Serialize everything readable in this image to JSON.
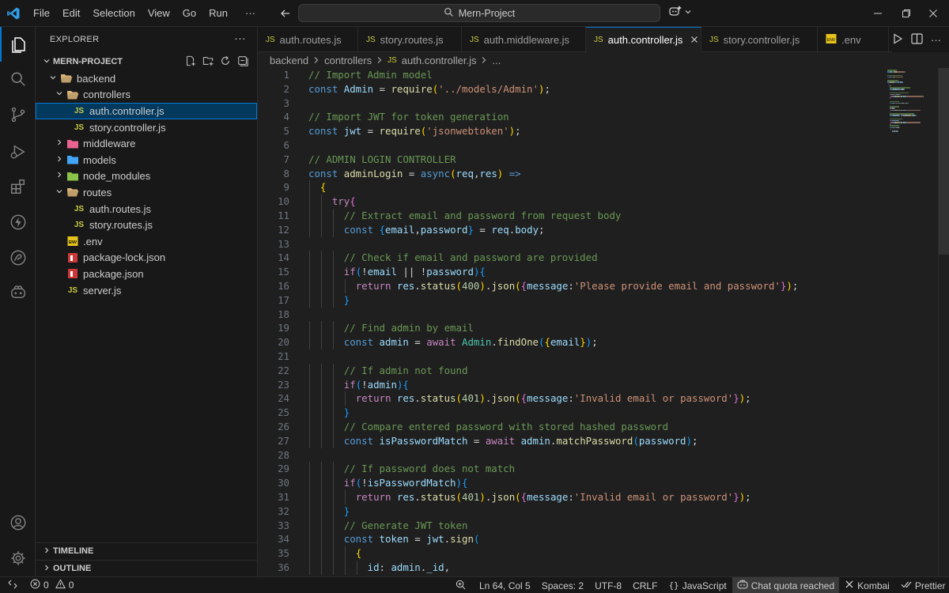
{
  "titlebar": {
    "menu": [
      "File",
      "Edit",
      "Selection",
      "View",
      "Go",
      "Run"
    ],
    "more": "···",
    "search_text": "Mern-Project"
  },
  "activity_bar": {
    "items": [
      "explorer-icon",
      "search-icon",
      "source-control-icon",
      "run-debug-icon",
      "extensions-icon",
      "lightning-icon",
      "docker-icon",
      "copilot-icon",
      "accounts-icon",
      "settings-gear-icon"
    ]
  },
  "sidebar": {
    "title": "EXPLORER",
    "project": "MERN-PROJECT",
    "tree": [
      {
        "label": "backend",
        "type": "folder",
        "open": true,
        "depth": 1
      },
      {
        "label": "controllers",
        "type": "folder",
        "open": true,
        "depth": 2
      },
      {
        "label": "auth.controller.js",
        "type": "js",
        "depth": 3,
        "selected": true
      },
      {
        "label": "story.controller.js",
        "type": "js",
        "depth": 3
      },
      {
        "label": "middleware",
        "type": "folder",
        "open": false,
        "depth": 2
      },
      {
        "label": "models",
        "type": "folder",
        "open": false,
        "depth": 2
      },
      {
        "label": "node_modules",
        "type": "folder",
        "open": false,
        "depth": 2
      },
      {
        "label": "routes",
        "type": "folder",
        "open": true,
        "depth": 2
      },
      {
        "label": "auth.routes.js",
        "type": "js",
        "depth": 3
      },
      {
        "label": "story.routes.js",
        "type": "js",
        "depth": 3
      },
      {
        "label": ".env",
        "type": "env",
        "depth": 2
      },
      {
        "label": "package-lock.json",
        "type": "npm",
        "depth": 2
      },
      {
        "label": "package.json",
        "type": "npm",
        "depth": 2
      },
      {
        "label": "server.js",
        "type": "js",
        "depth": 2
      }
    ],
    "timeline": "TIMELINE",
    "outline": "OUTLINE"
  },
  "tabs": [
    {
      "label": "auth.routes.js",
      "icon": "JS"
    },
    {
      "label": "story.routes.js",
      "icon": "JS"
    },
    {
      "label": "auth.middleware.js",
      "icon": "JS"
    },
    {
      "label": "auth.controller.js",
      "icon": "JS",
      "active": true
    },
    {
      "label": "story.controller.js",
      "icon": "JS"
    },
    {
      "label": ".env",
      "icon": "env"
    }
  ],
  "breadcrumb": {
    "parts": [
      "backend",
      "controllers",
      "auth.controller.js",
      "..."
    ],
    "icon": "JS"
  },
  "editor": {
    "lines": [
      {
        "n": "1",
        "tokens": [
          [
            "c-com",
            "// Import Admin model"
          ]
        ]
      },
      {
        "n": "2",
        "tokens": [
          [
            "c-kw",
            "const "
          ],
          [
            "c-var",
            "Admin"
          ],
          [
            "c-pun",
            " = "
          ],
          [
            "c-fn",
            "require"
          ],
          [
            "c-b1",
            "("
          ],
          [
            "c-str",
            "'../models/Admin'"
          ],
          [
            "c-b1",
            ")"
          ],
          [
            "c-pun",
            ";"
          ]
        ]
      },
      {
        "n": "3",
        "tokens": []
      },
      {
        "n": "4",
        "tokens": [
          [
            "c-com",
            "// Import JWT for token generation"
          ]
        ]
      },
      {
        "n": "5",
        "tokens": [
          [
            "c-kw",
            "const "
          ],
          [
            "c-var",
            "jwt"
          ],
          [
            "c-pun",
            " = "
          ],
          [
            "c-fn",
            "require"
          ],
          [
            "c-b1",
            "("
          ],
          [
            "c-str",
            "'jsonwebtoken'"
          ],
          [
            "c-b1",
            ")"
          ],
          [
            "c-pun",
            ";"
          ]
        ]
      },
      {
        "n": "6",
        "tokens": []
      },
      {
        "n": "7",
        "tokens": [
          [
            "c-com",
            "// ADMIN LOGIN CONTROLLER"
          ]
        ]
      },
      {
        "n": "8",
        "tokens": [
          [
            "c-kw",
            "const "
          ],
          [
            "c-fn",
            "adminLogin"
          ],
          [
            "c-pun",
            " = "
          ],
          [
            "c-kw",
            "async"
          ],
          [
            "c-b1",
            "("
          ],
          [
            "c-var",
            "req"
          ],
          [
            "c-pun",
            ","
          ],
          [
            "c-var",
            "res"
          ],
          [
            "c-b1",
            ")"
          ],
          [
            "c-kw",
            " =>"
          ]
        ]
      },
      {
        "n": "9",
        "tokens": [
          [
            "c-pun",
            "  "
          ],
          [
            "c-b1",
            "{"
          ]
        ]
      },
      {
        "n": "10",
        "tokens": [
          [
            "c-pun",
            "    "
          ],
          [
            "c-ctl",
            "try"
          ],
          [
            "c-b2",
            "{"
          ]
        ]
      },
      {
        "n": "11",
        "tokens": [
          [
            "c-pun",
            "      "
          ],
          [
            "c-com",
            "// Extract email and password from request body"
          ]
        ]
      },
      {
        "n": "12",
        "tokens": [
          [
            "c-pun",
            "      "
          ],
          [
            "c-kw",
            "const "
          ],
          [
            "c-b3",
            "{"
          ],
          [
            "c-var",
            "email"
          ],
          [
            "c-pun",
            ","
          ],
          [
            "c-var",
            "password"
          ],
          [
            "c-b3",
            "}"
          ],
          [
            "c-pun",
            " = "
          ],
          [
            "c-var",
            "req"
          ],
          [
            "c-pun",
            "."
          ],
          [
            "c-var",
            "body"
          ],
          [
            "c-pun",
            ";"
          ]
        ]
      },
      {
        "n": "13",
        "tokens": []
      },
      {
        "n": "14",
        "tokens": [
          [
            "c-pun",
            "      "
          ],
          [
            "c-com",
            "// Check if email and password are provided"
          ]
        ]
      },
      {
        "n": "15",
        "tokens": [
          [
            "c-pun",
            "      "
          ],
          [
            "c-ctl",
            "if"
          ],
          [
            "c-b3",
            "("
          ],
          [
            "c-pun",
            "!"
          ],
          [
            "c-var",
            "email"
          ],
          [
            "c-pun",
            " || !"
          ],
          [
            "c-var",
            "password"
          ],
          [
            "c-b3",
            ")"
          ],
          [
            "c-b3",
            "{"
          ]
        ]
      },
      {
        "n": "16",
        "tokens": [
          [
            "c-pun",
            "        "
          ],
          [
            "c-ctl",
            "return "
          ],
          [
            "c-var",
            "res"
          ],
          [
            "c-pun",
            "."
          ],
          [
            "c-fn",
            "status"
          ],
          [
            "c-b1",
            "("
          ],
          [
            "c-num",
            "400"
          ],
          [
            "c-b1",
            ")"
          ],
          [
            "c-pun",
            "."
          ],
          [
            "c-fn",
            "json"
          ],
          [
            "c-b1",
            "("
          ],
          [
            "c-b2",
            "{"
          ],
          [
            "c-var",
            "message"
          ],
          [
            "c-pun",
            ":"
          ],
          [
            "c-str",
            "'Please provide email and password'"
          ],
          [
            "c-b2",
            "}"
          ],
          [
            "c-b1",
            ")"
          ],
          [
            "c-pun",
            ";"
          ]
        ]
      },
      {
        "n": "17",
        "tokens": [
          [
            "c-pun",
            "      "
          ],
          [
            "c-b3",
            "}"
          ]
        ]
      },
      {
        "n": "18",
        "tokens": []
      },
      {
        "n": "19",
        "tokens": [
          [
            "c-pun",
            "      "
          ],
          [
            "c-com",
            "// Find admin by email"
          ]
        ]
      },
      {
        "n": "20",
        "tokens": [
          [
            "c-pun",
            "      "
          ],
          [
            "c-kw",
            "const "
          ],
          [
            "c-var",
            "admin"
          ],
          [
            "c-pun",
            " = "
          ],
          [
            "c-ctl",
            "await "
          ],
          [
            "c-cls",
            "Admin"
          ],
          [
            "c-pun",
            "."
          ],
          [
            "c-fn",
            "findOne"
          ],
          [
            "c-b3",
            "("
          ],
          [
            "c-b1",
            "{"
          ],
          [
            "c-var",
            "email"
          ],
          [
            "c-b1",
            "}"
          ],
          [
            "c-b3",
            ")"
          ],
          [
            "c-pun",
            ";"
          ]
        ]
      },
      {
        "n": "21",
        "tokens": []
      },
      {
        "n": "22",
        "tokens": [
          [
            "c-pun",
            "      "
          ],
          [
            "c-com",
            "// If admin not found"
          ]
        ]
      },
      {
        "n": "23",
        "tokens": [
          [
            "c-pun",
            "      "
          ],
          [
            "c-ctl",
            "if"
          ],
          [
            "c-b3",
            "("
          ],
          [
            "c-pun",
            "!"
          ],
          [
            "c-var",
            "admin"
          ],
          [
            "c-b3",
            ")"
          ],
          [
            "c-b3",
            "{"
          ]
        ]
      },
      {
        "n": "24",
        "tokens": [
          [
            "c-pun",
            "        "
          ],
          [
            "c-ctl",
            "return "
          ],
          [
            "c-var",
            "res"
          ],
          [
            "c-pun",
            "."
          ],
          [
            "c-fn",
            "status"
          ],
          [
            "c-b1",
            "("
          ],
          [
            "c-num",
            "401"
          ],
          [
            "c-b1",
            ")"
          ],
          [
            "c-pun",
            "."
          ],
          [
            "c-fn",
            "json"
          ],
          [
            "c-b1",
            "("
          ],
          [
            "c-b2",
            "{"
          ],
          [
            "c-var",
            "message"
          ],
          [
            "c-pun",
            ":"
          ],
          [
            "c-str",
            "'Invalid email or password'"
          ],
          [
            "c-b2",
            "}"
          ],
          [
            "c-b1",
            ")"
          ],
          [
            "c-pun",
            ";"
          ]
        ]
      },
      {
        "n": "25",
        "tokens": [
          [
            "c-pun",
            "      "
          ],
          [
            "c-b3",
            "}"
          ]
        ]
      },
      {
        "n": "26",
        "tokens": [
          [
            "c-pun",
            "      "
          ],
          [
            "c-com",
            "// Compare entered password with stored hashed password"
          ]
        ]
      },
      {
        "n": "27",
        "tokens": [
          [
            "c-pun",
            "      "
          ],
          [
            "c-kw",
            "const "
          ],
          [
            "c-var",
            "isPasswordMatch"
          ],
          [
            "c-pun",
            " = "
          ],
          [
            "c-ctl",
            "await "
          ],
          [
            "c-var",
            "admin"
          ],
          [
            "c-pun",
            "."
          ],
          [
            "c-fn",
            "matchPassword"
          ],
          [
            "c-b3",
            "("
          ],
          [
            "c-var",
            "password"
          ],
          [
            "c-b3",
            ")"
          ],
          [
            "c-pun",
            ";"
          ]
        ]
      },
      {
        "n": "28",
        "tokens": []
      },
      {
        "n": "29",
        "tokens": [
          [
            "c-pun",
            "      "
          ],
          [
            "c-com",
            "// If password does not match"
          ]
        ]
      },
      {
        "n": "30",
        "tokens": [
          [
            "c-pun",
            "      "
          ],
          [
            "c-ctl",
            "if"
          ],
          [
            "c-b3",
            "("
          ],
          [
            "c-pun",
            "!"
          ],
          [
            "c-var",
            "isPasswordMatch"
          ],
          [
            "c-b3",
            ")"
          ],
          [
            "c-b3",
            "{"
          ]
        ]
      },
      {
        "n": "31",
        "tokens": [
          [
            "c-pun",
            "        "
          ],
          [
            "c-ctl",
            "return "
          ],
          [
            "c-var",
            "res"
          ],
          [
            "c-pun",
            "."
          ],
          [
            "c-fn",
            "status"
          ],
          [
            "c-b1",
            "("
          ],
          [
            "c-num",
            "401"
          ],
          [
            "c-b1",
            ")"
          ],
          [
            "c-pun",
            "."
          ],
          [
            "c-fn",
            "json"
          ],
          [
            "c-b1",
            "("
          ],
          [
            "c-b2",
            "{"
          ],
          [
            "c-var",
            "message"
          ],
          [
            "c-pun",
            ":"
          ],
          [
            "c-str",
            "'Invalid email or password'"
          ],
          [
            "c-b2",
            "}"
          ],
          [
            "c-b1",
            ")"
          ],
          [
            "c-pun",
            ";"
          ]
        ]
      },
      {
        "n": "32",
        "tokens": [
          [
            "c-pun",
            "      "
          ],
          [
            "c-b3",
            "}"
          ]
        ]
      },
      {
        "n": "33",
        "tokens": [
          [
            "c-pun",
            "      "
          ],
          [
            "c-com",
            "// Generate JWT token"
          ]
        ]
      },
      {
        "n": "34",
        "tokens": [
          [
            "c-pun",
            "      "
          ],
          [
            "c-kw",
            "const "
          ],
          [
            "c-var",
            "token"
          ],
          [
            "c-pun",
            " = "
          ],
          [
            "c-var",
            "jwt"
          ],
          [
            "c-pun",
            "."
          ],
          [
            "c-fn",
            "sign"
          ],
          [
            "c-b3",
            "("
          ]
        ]
      },
      {
        "n": "35",
        "tokens": [
          [
            "c-pun",
            "        "
          ],
          [
            "c-b1",
            "{"
          ]
        ]
      },
      {
        "n": "36",
        "tokens": [
          [
            "c-pun",
            "          "
          ],
          [
            "c-var",
            "id"
          ],
          [
            "c-pun",
            ": "
          ],
          [
            "c-var",
            "admin"
          ],
          [
            "c-pun",
            "."
          ],
          [
            "c-var",
            "_id"
          ],
          [
            "c-pun",
            ","
          ]
        ]
      }
    ]
  },
  "statusbar": {
    "errors": "0",
    "warnings": "0",
    "position": "Ln 64, Col 5",
    "spaces": "Spaces: 2",
    "encoding": "UTF-8",
    "eol": "CRLF",
    "language": "JavaScript",
    "chat": "Chat quota reached",
    "kombai": "Kombai",
    "prettier": "Prettier"
  }
}
